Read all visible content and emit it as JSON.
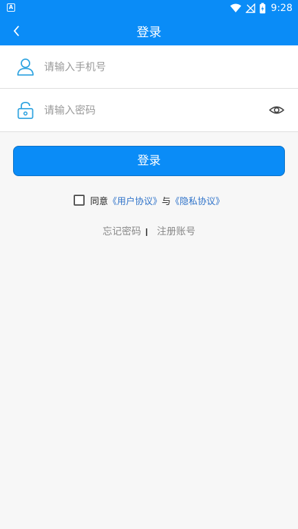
{
  "status_bar": {
    "app_icon": "A",
    "time": "9:28",
    "icons": [
      "wifi-icon",
      "no-signal-icon",
      "battery-charging-icon"
    ]
  },
  "header": {
    "title": "登录",
    "back_icon": "chevron-left-icon"
  },
  "form": {
    "phone": {
      "placeholder": "请输入手机号",
      "value": "",
      "icon": "user-icon"
    },
    "password": {
      "placeholder": "请输入密码",
      "value": "",
      "icon": "lock-icon",
      "toggle_icon": "eye-icon"
    }
  },
  "login_button": {
    "label": "登录"
  },
  "agreement": {
    "checked": false,
    "prefix": "同意",
    "user_agreement": "《用户协议》",
    "conjunction": "与",
    "privacy_agreement": "《隐私协议》"
  },
  "links": {
    "forgot_password": "忘记密码",
    "register": "注册账号"
  },
  "colors": {
    "primary": "#0a8cf7",
    "link": "#2e72c9",
    "background": "#f7f7f7",
    "icon_accent": "#2ea3e0"
  }
}
